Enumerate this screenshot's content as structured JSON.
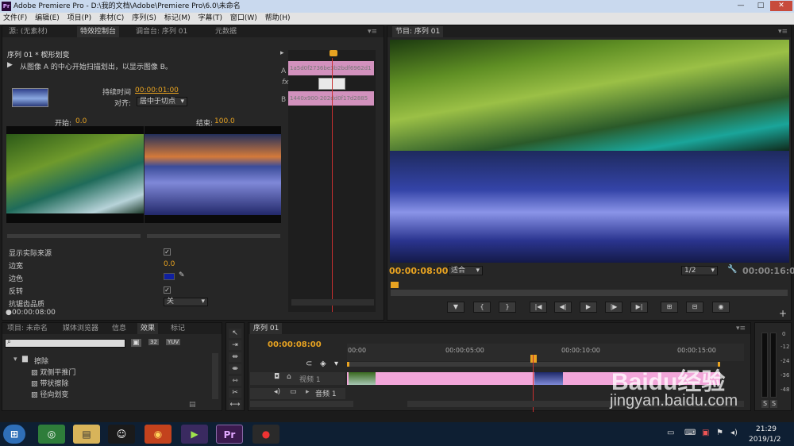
{
  "window": {
    "title": "Adobe Premiere Pro - D:\\我的文档\\Adobe\\Premiere Pro\\6.0\\未命名",
    "icon": "Pr",
    "controls": [
      "—",
      "□",
      "✕"
    ]
  },
  "menu": [
    "文件(F)",
    "编辑(E)",
    "项目(P)",
    "素材(C)",
    "序列(S)",
    "标记(M)",
    "字幕(T)",
    "窗口(W)",
    "帮助(H)"
  ],
  "top_left_tabs": [
    "源: (无素材)",
    "特效控制台",
    "调音台: 序列 01",
    "元数据"
  ],
  "effect_controls": {
    "header": "序列 01 * 楔形划变",
    "description": "从图像 A 的中心开始扫描划出，以显示图像 B。",
    "duration_label": "持续时间",
    "duration_value": "00:00:01:00",
    "align_label": "对齐:",
    "align_value": "居中于切点",
    "start_label": "开始:",
    "start_value": "0.0",
    "end_label": "结束:",
    "end_value": "100.0",
    "track_a": "A",
    "track_b": "B",
    "clip_a_name": "1a5d0f2736be3b2bdf6962d1",
    "clip_b_name": "1440x900-202dd0f17d2885",
    "props": [
      {
        "label": "显示实际来源",
        "value": "✓"
      },
      {
        "label": "边宽",
        "value": "0.0"
      },
      {
        "label": "边色",
        "value": ""
      },
      {
        "label": "反转",
        "value": "✓"
      },
      {
        "label": "抗锯齿品质",
        "value": "关"
      }
    ],
    "timecode": "00:00:08:00",
    "edge_color": "#1020a0"
  },
  "program": {
    "tab": "节目: 序列 01",
    "timecode": "00:00:08:00",
    "fit": "适合",
    "resolution": "1/2",
    "duration": "00:00:16:00",
    "controls": [
      "▼",
      "{",
      "}",
      "|◀",
      "◀|",
      "▶",
      "|▶",
      "▶|",
      "⊞",
      "⊟",
      "◉"
    ]
  },
  "project_tabs": [
    "项目: 未命名",
    "媒体浏览器",
    "信息",
    "效果",
    "标记"
  ],
  "effects_tree": {
    "folder": "擦除",
    "items": [
      "双侧平推门",
      "带状擦除",
      "径向划变"
    ]
  },
  "timeline": {
    "tab": "序列 01",
    "timecode": "00:00:08:00",
    "ruler": [
      "00:00",
      "00:00:05:00",
      "00:00:10:00",
      "00:00:15:00"
    ],
    "tracks": [
      {
        "name": "视频 1"
      },
      {
        "name": "音频 1"
      }
    ]
  },
  "audio_meter": {
    "labels": [
      "0",
      "-12",
      "-24",
      "-36",
      "-48"
    ],
    "buttons": [
      "S",
      "S"
    ]
  },
  "taskbar": {
    "time": "21:29",
    "date": "2019/1/2"
  },
  "watermark": {
    "logo": "Baidu经验",
    "url": "jingyan.baidu.com"
  },
  "colors": {
    "accent": "#e8a321",
    "transition": "#f2a6d9",
    "playhead": "#c83030"
  }
}
